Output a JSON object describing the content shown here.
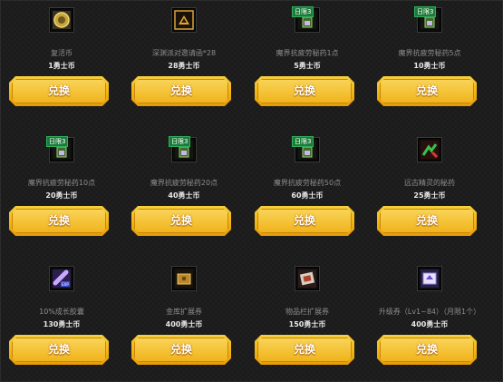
{
  "badge_label": "日限3",
  "button_label": "兑换",
  "items": [
    {
      "name": "复活币",
      "price": "1勇士币",
      "icon": "resurrection-coin-icon",
      "badge": false
    },
    {
      "name": "深渊派对邀请函*28",
      "price": "28勇士币",
      "icon": "abyss-party-invitation-icon",
      "badge": false
    },
    {
      "name": "魔界抗疲劳秘药1点",
      "price": "5勇士币",
      "icon": "anti-fatigue-potion-icon",
      "badge": true
    },
    {
      "name": "魔界抗疲劳秘药5点",
      "price": "10勇士币",
      "icon": "anti-fatigue-potion-icon",
      "badge": true
    },
    {
      "name": "魔界抗疲劳秘药10点",
      "price": "20勇士币",
      "icon": "anti-fatigue-potion-icon",
      "badge": true
    },
    {
      "name": "魔界抗疲劳秘药20点",
      "price": "40勇士币",
      "icon": "anti-fatigue-potion-icon",
      "badge": true
    },
    {
      "name": "魔界抗疲劳秘药50点",
      "price": "60勇士币",
      "icon": "anti-fatigue-potion-icon",
      "badge": true
    },
    {
      "name": "远古精灵的秘药",
      "price": "25勇士币",
      "icon": "ancient-elf-potion-icon",
      "badge": false
    },
    {
      "name": "10%成长胶囊",
      "price": "130勇士币",
      "icon": "exp-capsule-icon",
      "badge": false
    },
    {
      "name": "金库扩展券",
      "price": "400勇士币",
      "icon": "vault-expansion-ticket-icon",
      "badge": false
    },
    {
      "name": "物品栏扩展券",
      "price": "150勇士币",
      "icon": "inventory-expansion-ticket-icon",
      "badge": false
    },
    {
      "name": "升级券（Lv1~84）（月限1个）",
      "price": "400勇士币",
      "icon": "level-up-ticket-icon",
      "badge": false
    }
  ]
}
